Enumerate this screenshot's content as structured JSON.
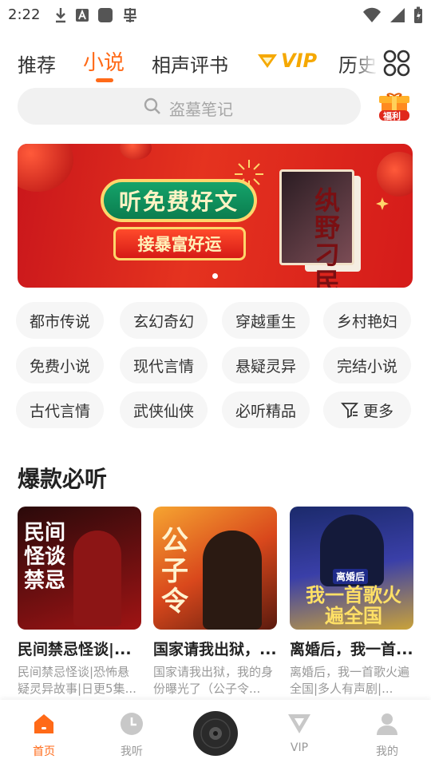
{
  "status_bar": {
    "time": "2:22"
  },
  "tabs": [
    {
      "label": "推荐"
    },
    {
      "label": "小说"
    },
    {
      "label": "相声评书"
    },
    {
      "label": "VIP"
    },
    {
      "label": "历史"
    }
  ],
  "search": {
    "placeholder": "盗墓笔记"
  },
  "gift": {
    "label": "福利"
  },
  "banner": {
    "headline": "听免费好文",
    "subline": "接暴富好运",
    "book_title": "纨野刁民"
  },
  "categories": [
    "都市传说",
    "玄幻奇幻",
    "穿越重生",
    "乡村艳妇",
    "免费小说",
    "现代言情",
    "悬疑灵异",
    "完结小说",
    "古代言情",
    "武侠仙侠",
    "必听精品",
    "更多"
  ],
  "section": {
    "title": "爆款必听",
    "books": [
      {
        "cover_text": "民间怪谈禁忌",
        "title": "民间禁忌怪谈|...",
        "desc": "民间禁忌怪谈|恐怖悬疑灵异故事|日更5集..."
      },
      {
        "cover_text": "公子令",
        "title": "国家请我出狱，...",
        "desc": "国家请我出狱，我的身份曝光了（公子令..."
      },
      {
        "cover_text": "我一首歌火遍全国",
        "cover_badge": "离婚后",
        "title": "离婚后，我一首...",
        "desc": "离婚后，我一首歌火遍全国|多人有声剧|..."
      }
    ]
  },
  "bottom_nav": [
    {
      "label": "首页"
    },
    {
      "label": "我听"
    },
    {
      "label": "VIP"
    },
    {
      "label": "我的"
    }
  ],
  "colors": {
    "accent": "#ff6a18",
    "vip": "#f5a800"
  }
}
